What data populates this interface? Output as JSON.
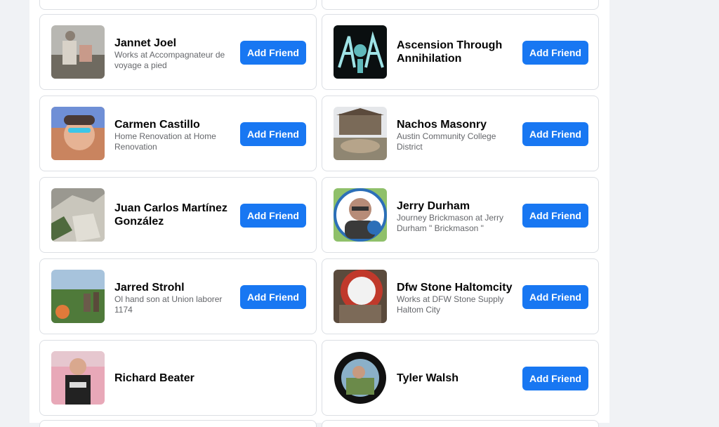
{
  "suggestions": [
    {
      "name": "Jannet Joel",
      "subtitle": "Works at Accompagnateur de voyage a pied",
      "button": "Add Friend",
      "avatar_icon": "person-photo-icon"
    },
    {
      "name": "Ascension Through Annihilation",
      "subtitle": "",
      "button": "Add Friend",
      "avatar_icon": "band-logo-icon"
    },
    {
      "name": "Carmen Castillo",
      "subtitle": "Home Renovation at Home Renovation",
      "button": "Add Friend",
      "avatar_icon": "person-photo-icon"
    },
    {
      "name": "Nachos Masonry",
      "subtitle": "Austin Community College District",
      "button": "Add Friend",
      "avatar_icon": "masonry-photo-icon"
    },
    {
      "name": "Juan Carlos Martínez González",
      "subtitle": "",
      "button": "Add Friend",
      "avatar_icon": "rock-photo-icon"
    },
    {
      "name": "Jerry Durham",
      "subtitle": "Journey Brickmason at Jerry Durham \" Brickmason \"",
      "button": "Add Friend",
      "avatar_icon": "person-photo-icon"
    },
    {
      "name": "Jarred Strohl",
      "subtitle": "Ol hand son at Union laborer 1174",
      "button": "Add Friend",
      "avatar_icon": "outdoor-photo-icon"
    },
    {
      "name": "Dfw Stone Haltomcity",
      "subtitle": "Works at DFW Stone Supply Haltom City",
      "button": "Add Friend",
      "avatar_icon": "logo-photo-icon"
    },
    {
      "name": "Richard Beater",
      "subtitle": "",
      "button": "",
      "avatar_icon": "person-photo-icon"
    },
    {
      "name": "Tyler Walsh",
      "subtitle": "",
      "button": "Add Friend",
      "avatar_icon": "person-photo-icon"
    }
  ],
  "colors": {
    "accent": "#1877f2",
    "page_bg": "#f0f2f5",
    "card_border": "#dcdfe4"
  }
}
